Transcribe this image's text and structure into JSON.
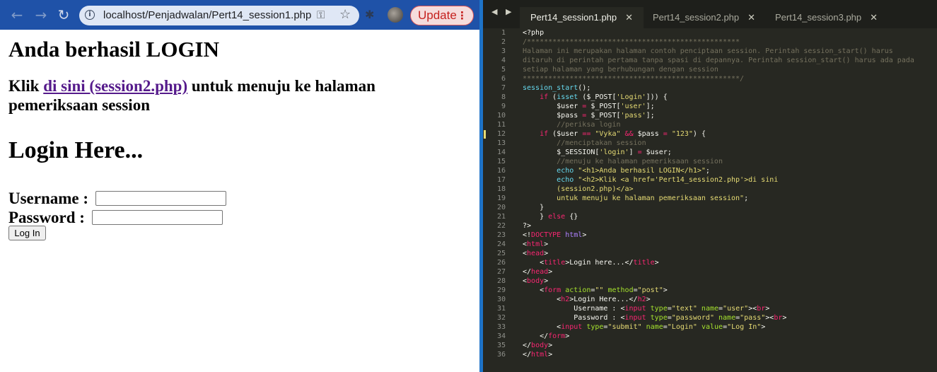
{
  "browser": {
    "nav": {
      "back": "←",
      "forward": "→",
      "reload": "↻"
    },
    "url": "localhost/Penjadwalan/Pert14_session1.php",
    "update_label": "Update",
    "icons": [
      "info-icon",
      "key-icon",
      "star-icon",
      "extensions-icon",
      "avatar",
      "menu-dots-icon"
    ]
  },
  "page": {
    "h1": "Anda berhasil LOGIN",
    "h2_prefix": "Klik ",
    "h2_link": "di sini (session2.php)",
    "h2_suffix": " untuk menuju ke halaman pemeriksaan session",
    "login_heading": "Login Here...",
    "username_label": "Username :",
    "password_label": "Password :",
    "username_value": "",
    "password_value": "",
    "submit_label": "Log In"
  },
  "editor": {
    "tabs": [
      {
        "label": "Pert14_session1.php",
        "active": true
      },
      {
        "label": "Pert14_session2.php",
        "active": false
      },
      {
        "label": "Pert14_session3.php",
        "active": false
      }
    ],
    "code_lines": [
      [
        [
          "pl",
          "<?php"
        ]
      ],
      [
        [
          "com",
          "/**************************************************"
        ]
      ],
      [
        [
          "com",
          "Halaman ini merupakan halaman contoh penciptaan session. Perintah session_start() harus"
        ]
      ],
      [
        [
          "com",
          "ditaruh di perintah pertama tanpa spasi di depannya. Perintah session_start() harus ada pada"
        ]
      ],
      [
        [
          "com",
          "setiap halaman yang berhubungan dengan session"
        ]
      ],
      [
        [
          "com",
          "***************************************************/"
        ]
      ],
      [
        [
          "fn",
          "session_start"
        ],
        [
          "pl",
          "();"
        ]
      ],
      [
        [
          "pl",
          "    "
        ],
        [
          "kw",
          "if"
        ],
        [
          "pl",
          " ("
        ],
        [
          "fn",
          "isset"
        ],
        [
          "pl",
          " ($_POST["
        ],
        [
          "str",
          "'Login'"
        ],
        [
          "pl",
          "])) {"
        ]
      ],
      [
        [
          "pl",
          "        $user "
        ],
        [
          "kw",
          "="
        ],
        [
          "pl",
          " $_POST["
        ],
        [
          "str",
          "'user'"
        ],
        [
          "pl",
          "];"
        ]
      ],
      [
        [
          "pl",
          "        $pass "
        ],
        [
          "kw",
          "="
        ],
        [
          "pl",
          " $_POST["
        ],
        [
          "str",
          "'pass'"
        ],
        [
          "pl",
          "];"
        ]
      ],
      [
        [
          "pl",
          "        "
        ],
        [
          "com",
          "//periksa login"
        ]
      ],
      [
        [
          "pl",
          "    "
        ],
        [
          "kw",
          "if"
        ],
        [
          "pl",
          " ($user "
        ],
        [
          "kw",
          "=="
        ],
        [
          "pl",
          " "
        ],
        [
          "str",
          "\"Vyka\""
        ],
        [
          "pl",
          " "
        ],
        [
          "kw",
          "&&"
        ],
        [
          "pl",
          " $pass "
        ],
        [
          "kw",
          "="
        ],
        [
          "pl",
          " "
        ],
        [
          "str",
          "\"123\""
        ],
        [
          "pl",
          ") {"
        ]
      ],
      [
        [
          "pl",
          "        "
        ],
        [
          "com",
          "//menciptakan session"
        ]
      ],
      [
        [
          "pl",
          "        $_SESSION["
        ],
        [
          "str",
          "'login'"
        ],
        [
          "pl",
          "] "
        ],
        [
          "kw",
          "="
        ],
        [
          "pl",
          " $user;"
        ]
      ],
      [
        [
          "pl",
          "        "
        ],
        [
          "com",
          "//menuju ke halaman pemeriksaan session"
        ]
      ],
      [
        [
          "pl",
          "        "
        ],
        [
          "fn",
          "echo"
        ],
        [
          "pl",
          " "
        ],
        [
          "str",
          "\"<h1>Anda berhasil LOGIN</h1>\""
        ],
        [
          "pl",
          ";"
        ]
      ],
      [
        [
          "pl",
          "        "
        ],
        [
          "fn",
          "echo"
        ],
        [
          "pl",
          " "
        ],
        [
          "str",
          "\"<h2>Klik <a href='Pert14_session2.php'>di sini"
        ]
      ],
      [
        [
          "pl",
          "        "
        ],
        [
          "str",
          "(session2.php)</a>"
        ]
      ],
      [
        [
          "pl",
          "        "
        ],
        [
          "str",
          "untuk menuju ke halaman pemeriksaan session\""
        ],
        [
          "pl",
          ";"
        ]
      ],
      [
        [
          "pl",
          "    }"
        ]
      ],
      [
        [
          "pl",
          "    } "
        ],
        [
          "kw",
          "else"
        ],
        [
          "pl",
          " {}"
        ]
      ],
      [
        [
          "pl",
          "?>"
        ]
      ],
      [
        [
          "pl",
          "<!"
        ],
        [
          "kw",
          "DOCTYPE"
        ],
        [
          "pl",
          " "
        ],
        [
          "pur",
          "html"
        ],
        [
          "pl",
          ">"
        ]
      ],
      [
        [
          "pl",
          "<"
        ],
        [
          "kw",
          "html"
        ],
        [
          "pl",
          ">"
        ]
      ],
      [
        [
          "pl",
          "<"
        ],
        [
          "kw",
          "head"
        ],
        [
          "pl",
          ">"
        ]
      ],
      [
        [
          "pl",
          "    <"
        ],
        [
          "kw",
          "title"
        ],
        [
          "pl",
          ">Login here...</"
        ],
        [
          "kw",
          "title"
        ],
        [
          "pl",
          ">"
        ]
      ],
      [
        [
          "pl",
          "</"
        ],
        [
          "kw",
          "head"
        ],
        [
          "pl",
          ">"
        ]
      ],
      [
        [
          "pl",
          "<"
        ],
        [
          "kw",
          "body"
        ],
        [
          "pl",
          ">"
        ]
      ],
      [
        [
          "pl",
          "    <"
        ],
        [
          "kw",
          "form"
        ],
        [
          "pl",
          " "
        ],
        [
          "attr",
          "action"
        ],
        [
          "pl",
          "="
        ],
        [
          "str",
          "\"\""
        ],
        [
          "pl",
          " "
        ],
        [
          "attr",
          "method"
        ],
        [
          "pl",
          "="
        ],
        [
          "str",
          "\"post\""
        ],
        [
          "pl",
          ">"
        ]
      ],
      [
        [
          "pl",
          "        <"
        ],
        [
          "kw",
          "h2"
        ],
        [
          "pl",
          ">Login Here...</"
        ],
        [
          "kw",
          "h2"
        ],
        [
          "pl",
          ">"
        ]
      ],
      [
        [
          "pl",
          "            Username : <"
        ],
        [
          "kw",
          "input"
        ],
        [
          "pl",
          " "
        ],
        [
          "attr",
          "type"
        ],
        [
          "pl",
          "="
        ],
        [
          "str",
          "\"text\""
        ],
        [
          "pl",
          " "
        ],
        [
          "attr",
          "name"
        ],
        [
          "pl",
          "="
        ],
        [
          "str",
          "\"user\""
        ],
        [
          "pl",
          "><"
        ],
        [
          "kw",
          "br"
        ],
        [
          "pl",
          ">"
        ]
      ],
      [
        [
          "pl",
          "            Password : <"
        ],
        [
          "kw",
          "input"
        ],
        [
          "pl",
          " "
        ],
        [
          "attr",
          "type"
        ],
        [
          "pl",
          "="
        ],
        [
          "str",
          "\"password\""
        ],
        [
          "pl",
          " "
        ],
        [
          "attr",
          "name"
        ],
        [
          "pl",
          "="
        ],
        [
          "str",
          "\"pass\""
        ],
        [
          "pl",
          "><"
        ],
        [
          "kw",
          "br"
        ],
        [
          "pl",
          ">"
        ]
      ],
      [
        [
          "pl",
          "        <"
        ],
        [
          "kw",
          "input"
        ],
        [
          "pl",
          " "
        ],
        [
          "attr",
          "type"
        ],
        [
          "pl",
          "="
        ],
        [
          "str",
          "\"submit\""
        ],
        [
          "pl",
          " "
        ],
        [
          "attr",
          "name"
        ],
        [
          "pl",
          "="
        ],
        [
          "str",
          "\"Login\""
        ],
        [
          "pl",
          " "
        ],
        [
          "attr",
          "value"
        ],
        [
          "pl",
          "="
        ],
        [
          "str",
          "\"Log In\""
        ],
        [
          "pl",
          ">"
        ]
      ],
      [
        [
          "pl",
          "    </"
        ],
        [
          "kw",
          "form"
        ],
        [
          "pl",
          ">"
        ]
      ],
      [
        [
          "pl",
          "</"
        ],
        [
          "kw",
          "body"
        ],
        [
          "pl",
          ">"
        ]
      ],
      [
        [
          "pl",
          "</"
        ],
        [
          "kw",
          "html"
        ],
        [
          "pl",
          ">"
        ]
      ]
    ]
  },
  "colors": {
    "toolbar": "#1f52a8",
    "link": "#551a8b",
    "update": "#c5221f",
    "editor_bg": "#272822",
    "keyword": "#f92672",
    "string": "#e6db74",
    "function": "#66d9ef",
    "comment": "#75715e",
    "attribute": "#a6e22e"
  }
}
